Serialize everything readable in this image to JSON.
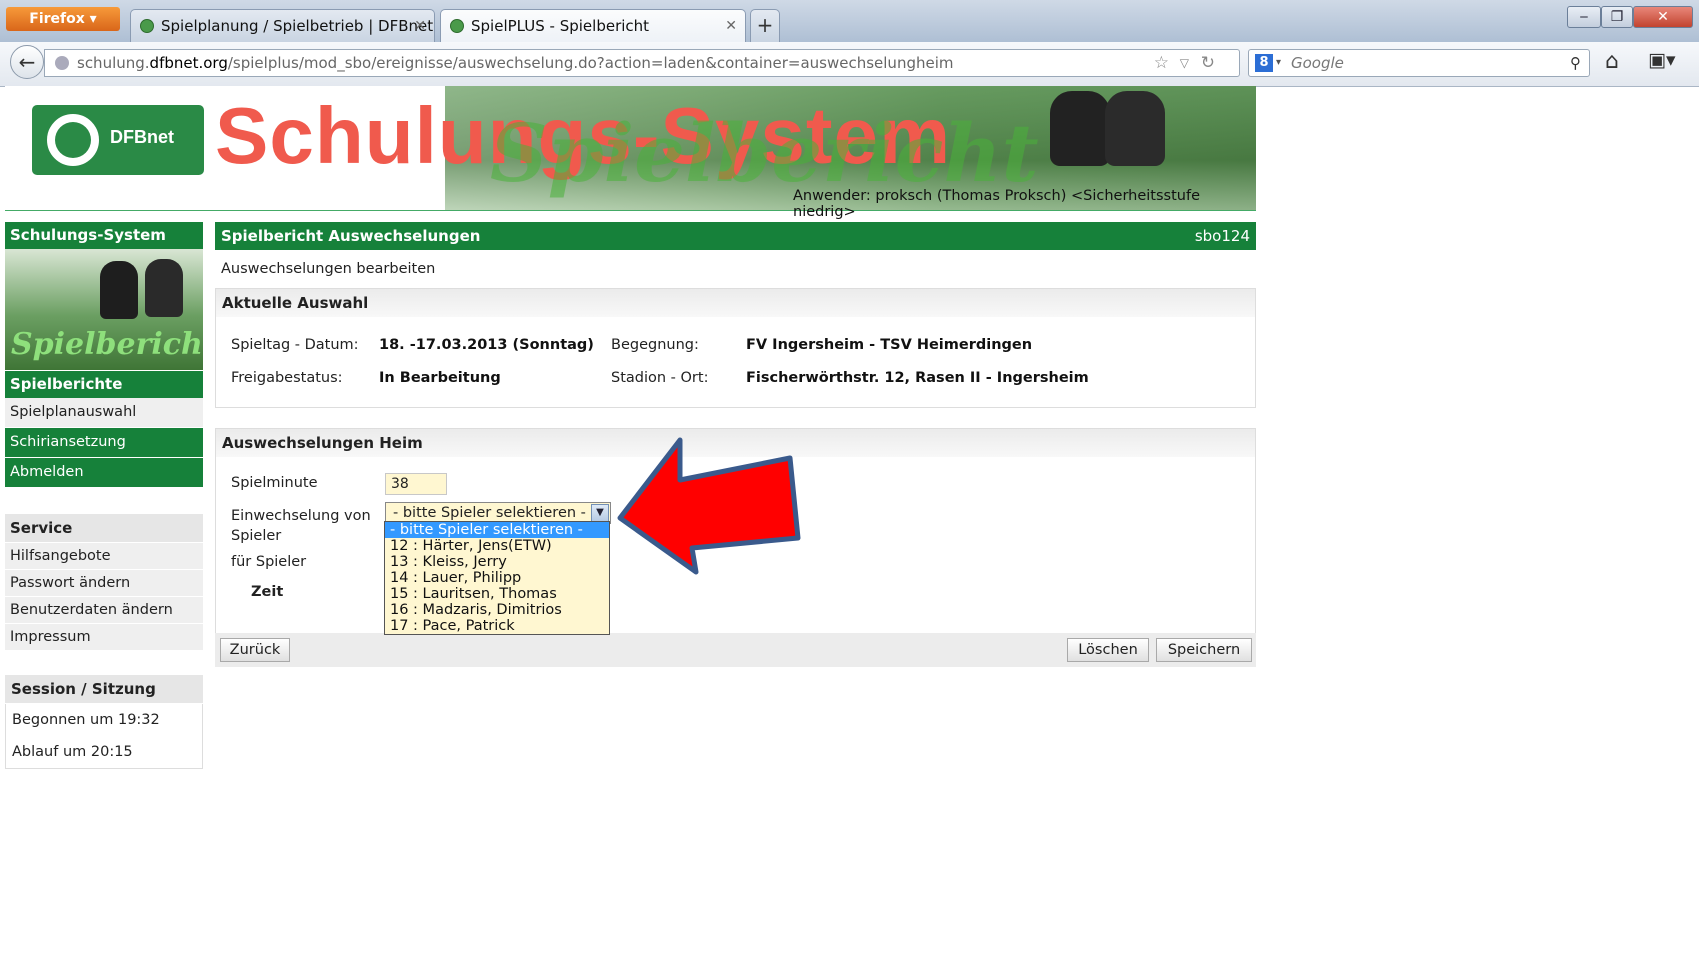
{
  "browser": {
    "menu_label": "Firefox",
    "tabs": [
      {
        "title": "Spielplanung / Spielbetrieb | DFBnet",
        "active": false
      },
      {
        "title": "SpielPLUS - Spielbericht",
        "active": true
      }
    ],
    "new_tab": "+",
    "url_host_prefix": "schulung.",
    "url_host": "dfbnet.org",
    "url_path": "/spielplus/mod_sbo/ereignisse/auswechselung.do?action=laden&container=auswechselungheim",
    "search_placeholder": "Google",
    "search_engine_glyph": "8"
  },
  "banner": {
    "logo_text": "DFBnet",
    "title": "Schulungs-System",
    "subtitle_script": "Spielbericht",
    "user_info": "Anwender: proksch (Thomas Proksch) <Sicherheitsstufe niedrig>"
  },
  "sidebar": {
    "system_head": "Schulungs-System",
    "image_text": "Spielbericht",
    "section_head": "Spielberichte",
    "items": [
      "Spielplanauswahl",
      "Schiriansetzung",
      "Abmelden"
    ],
    "service_head": "Service",
    "service_items": [
      "Hilfsangebote",
      "Passwort ändern",
      "Benutzerdaten ändern",
      "Impressum"
    ],
    "session_head": "Session / Sitzung",
    "session_started": "Begonnen um 19:32",
    "session_expires": "Ablauf um 20:15"
  },
  "main": {
    "title": "Spielbericht Auswechselungen",
    "code": "sbo124",
    "subtitle": "Auswechselungen bearbeiten",
    "selection": {
      "head": "Aktuelle Auswahl",
      "spieltag_label": "Spieltag - Datum:",
      "spieltag_value": "18. -17.03.2013 (Sonntag)",
      "begegnung_label": "Begegnung:",
      "begegnung_value": "FV Ingersheim - TSV Heimerdingen",
      "freigabe_label": "Freigabestatus:",
      "freigabe_value": "In Bearbeitung",
      "stadion_label": "Stadion - Ort:",
      "stadion_value": "Fischerwörthstr. 12, Rasen II - Ingersheim"
    },
    "substitution": {
      "head": "Auswechselungen Heim",
      "minute_label": "Spielminute",
      "minute_value": "38",
      "einw_label": "Einwechselung von",
      "einw_label2": "Spieler",
      "einw_selected": "- bitte Spieler selektieren -",
      "fuer_label": "für Spieler",
      "zeit_label": "Zeit",
      "options": [
        "- bitte Spieler selektieren -",
        "12 : Härter, Jens(ETW)",
        "13 : Kleiss, Jerry",
        "14 : Lauer, Philipp",
        "15 : Lauritsen, Thomas",
        "16 : Madzaris, Dimitrios",
        "17 : Pace, Patrick"
      ]
    },
    "buttons": {
      "back": "Zurück",
      "delete": "Löschen",
      "save": "Speichern"
    }
  },
  "colors": {
    "brand_green": "#16813a",
    "annotation_arrow": "#ff0000",
    "arrow_outline": "#3a5a8c",
    "input_bg": "#fff7d1"
  }
}
